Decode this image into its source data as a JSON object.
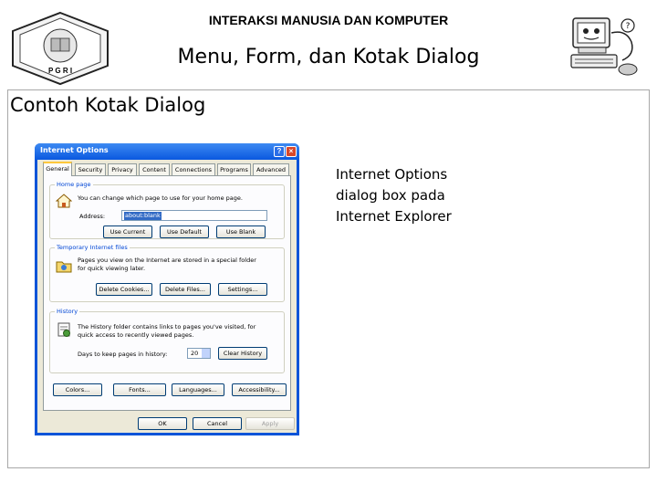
{
  "slide": {
    "course_title": "INTERAKSI MANUSIA DAN KOMPUTER",
    "title": "Menu, Form, dan Kotak Dialog",
    "section_title": "Contoh Kotak Dialog",
    "caption_lines": [
      "Internet Options",
      "dialog box pada",
      "Internet Explorer"
    ],
    "logo_left_text": "P G R I"
  },
  "dialog": {
    "title": "Internet Options",
    "title_buttons": [
      "?",
      "×"
    ],
    "tabs": [
      "General",
      "Security",
      "Privacy",
      "Content",
      "Connections",
      "Programs",
      "Advanced"
    ],
    "active_tab": "General",
    "home_page": {
      "label": "Home page",
      "text": "You can change which page to use for your home page.",
      "address_label": "Address:",
      "address_value": "about:blank",
      "buttons": [
        "Use Current",
        "Use Default",
        "Use Blank"
      ]
    },
    "temp_files": {
      "label": "Temporary Internet files",
      "text_lines": [
        "Pages you view on the Internet are stored in a special folder",
        "for quick viewing later."
      ],
      "buttons": [
        "Delete Cookies...",
        "Delete Files...",
        "Settings..."
      ]
    },
    "history": {
      "label": "History",
      "text_lines": [
        "The History folder contains links to pages you've visited, for",
        "quick access to recently viewed pages."
      ],
      "days_label": "Days to keep pages in history:",
      "days_value": "20",
      "button": "Clear History"
    },
    "bottom_buttons": [
      "Colors...",
      "Fonts...",
      "Languages...",
      "Accessibility..."
    ],
    "footer_buttons": [
      "OK",
      "Cancel",
      "Apply"
    ]
  },
  "colors": {
    "xp_title_blue": "#0a54d8",
    "dialog_face": "#ece9d8",
    "group_label_blue": "#0046d5"
  }
}
